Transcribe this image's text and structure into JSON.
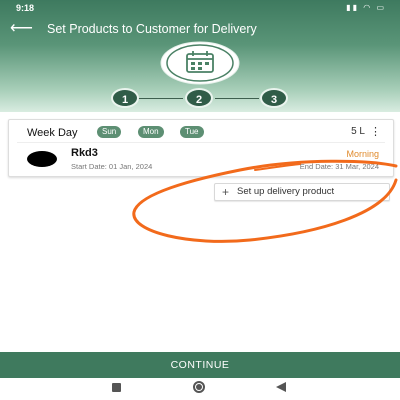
{
  "status": {
    "time": "9:18",
    "battery": "35"
  },
  "header": {
    "title": "Set Products to Customer for Delivery",
    "icon": "calendar-icon"
  },
  "stepper": {
    "steps": [
      "1",
      "2",
      "3"
    ]
  },
  "card": {
    "week_day_label": "Week Day",
    "days": [
      "Sun",
      "Mon",
      "Tue"
    ],
    "quantity": "5 L",
    "customer_name": "Rkd3",
    "start_date": "Start Date: 01 Jan, 2024",
    "shift": "Morning",
    "end_date": "End Date: 31 Mar, 2024"
  },
  "setup_button": {
    "label": "Set up delivery product"
  },
  "continue_button": {
    "label": "CONTINUE"
  },
  "colors": {
    "primary": "#3f7a5e",
    "chip": "#5d8f73",
    "shift": "#e08a2c",
    "annotation": "#f26a1b"
  }
}
